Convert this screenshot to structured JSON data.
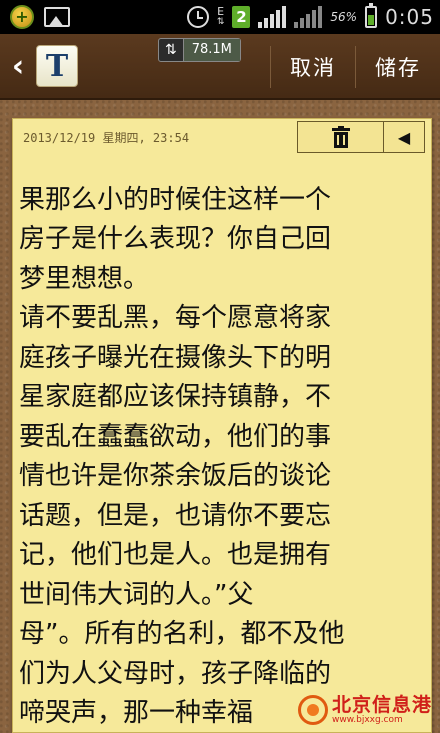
{
  "status_bar": {
    "network_letter": "E",
    "notification_count": "2",
    "battery_percent": "56%",
    "battery_level": 0.56,
    "time": "0:05",
    "icons": [
      "app-notification-icon",
      "gallery-icon",
      "alarm-icon",
      "data-arrows-icon",
      "signal-icon",
      "battery-icon"
    ]
  },
  "action_bar": {
    "app_icon_letter": "T",
    "memory_value": "78.1M",
    "cancel_label": "取消",
    "save_label": "储存"
  },
  "note": {
    "date": "2013/12/19 星期四, 23:54",
    "lines": [
      "果那么小的时候住这样一个",
      "果那么小的时候住这样一个",
      "房子是什么表现？你自己回",
      "梦里想想。",
      "请不要乱黑，每个愿意将家",
      "庭孩子曝光在摄像头下的明",
      "星家庭都应该保持镇静，不",
      "要乱在蠢蠢欲动，他们的事",
      "情也许是你茶余饭后的谈论",
      "话题，但是，也请你不要忘",
      "记，他们也是人。也是拥有",
      "世间伟大词的人。”父",
      "母”。所有的名利，都不及他",
      "们为人父母时，孩子降临的",
      "啼哭声，那一种幸福"
    ]
  },
  "watermark": {
    "title": "北京信息港",
    "url": "www.bjxxg.com"
  },
  "colors": {
    "note_paper": "#f6e99a",
    "action_bar": "#4f321a",
    "cork": "#8a6440",
    "watermark_red": "#d0201a"
  }
}
